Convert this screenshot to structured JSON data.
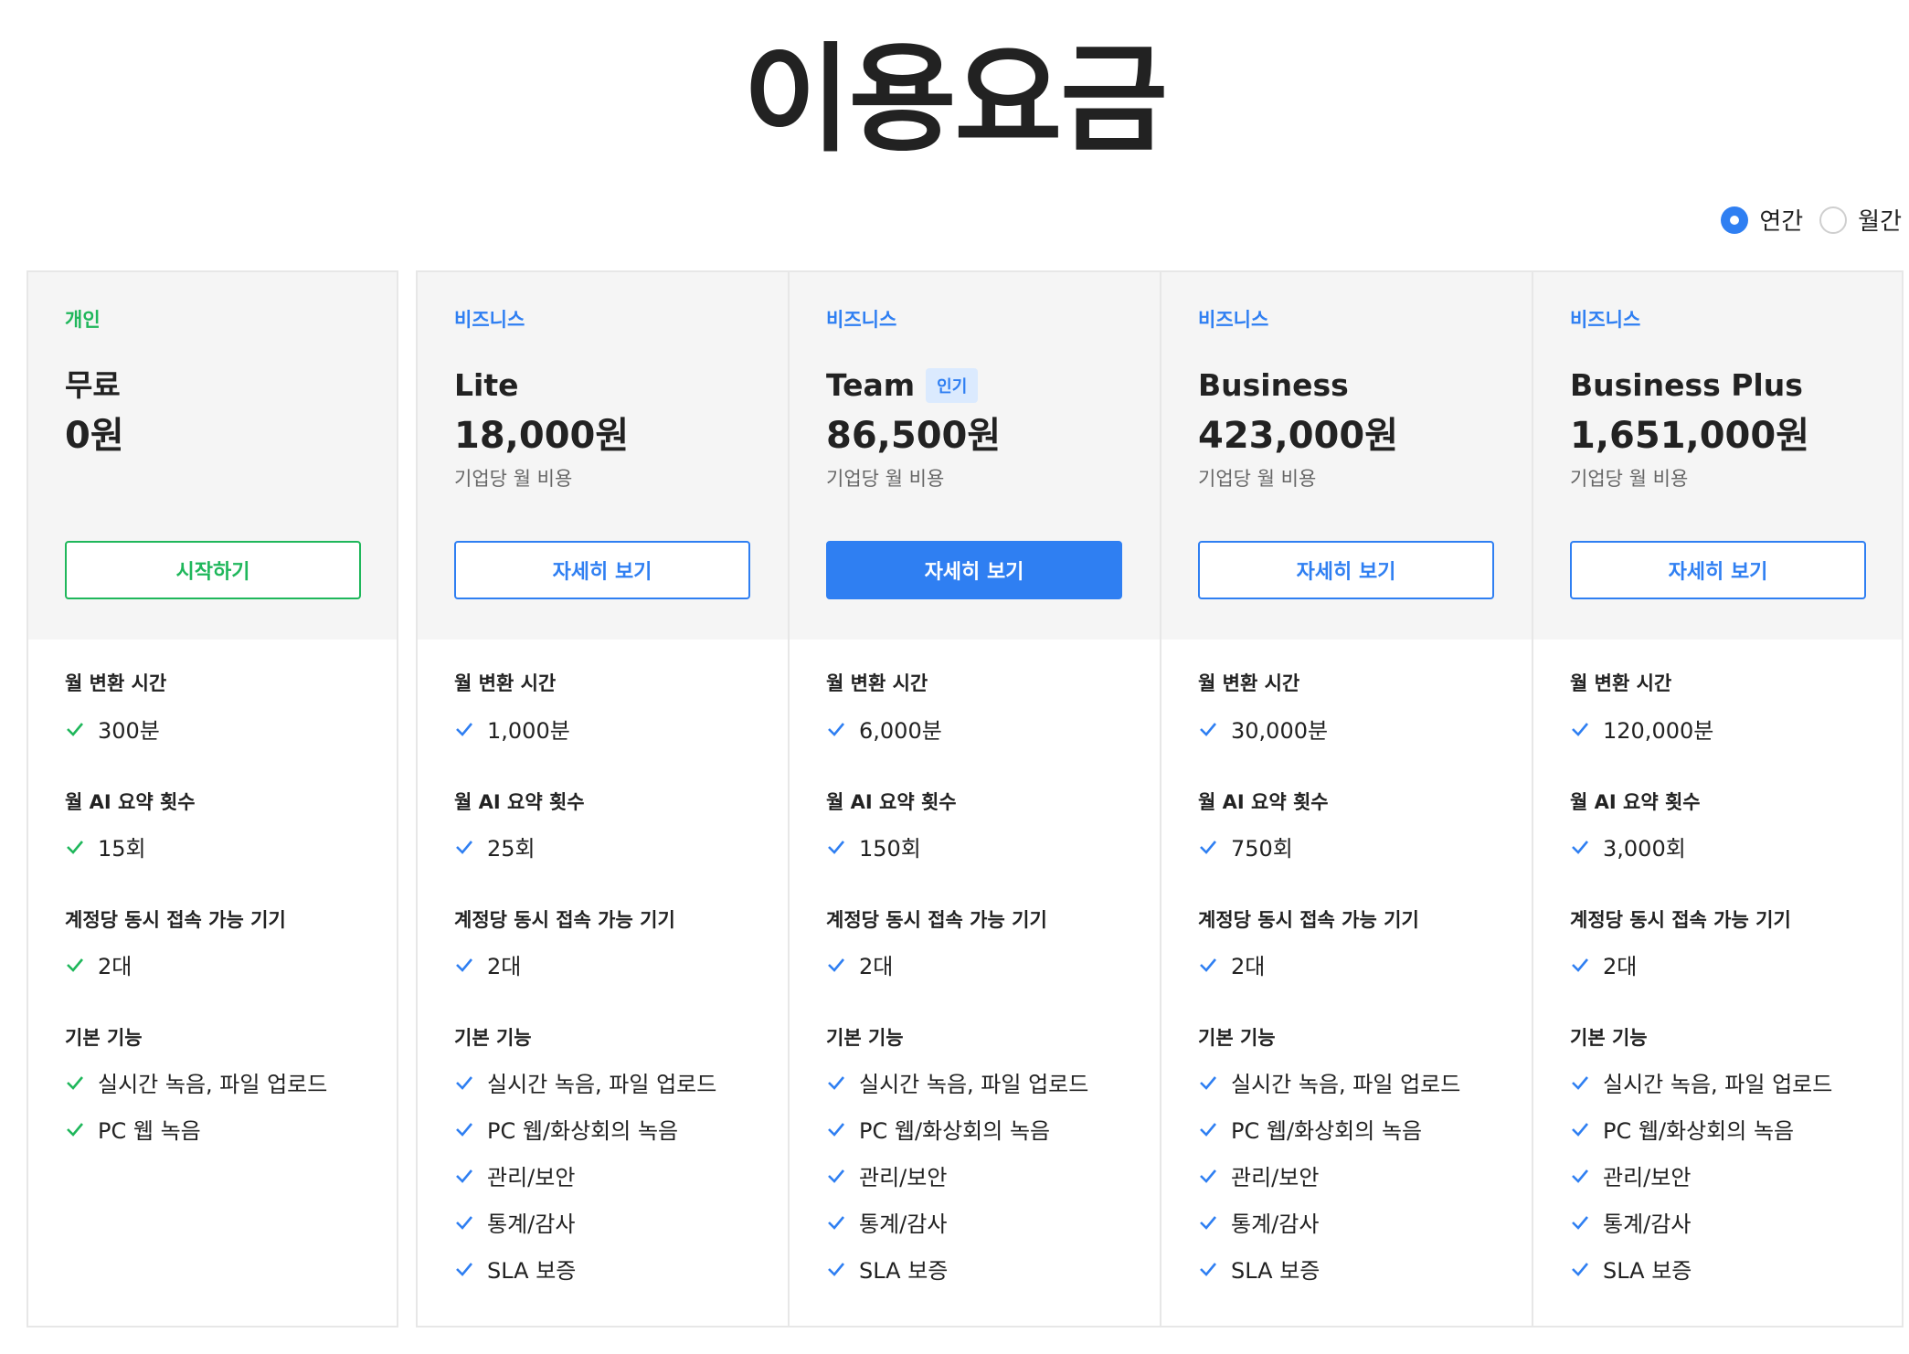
{
  "page": {
    "title": "이용요금"
  },
  "billing_toggle": {
    "options": [
      {
        "label": "연간",
        "selected": true
      },
      {
        "label": "월간",
        "selected": false
      }
    ]
  },
  "colors": {
    "green": "#1fb75b",
    "blue": "#2f7ff2",
    "card_top_bg": "#f5f5f5"
  },
  "section_labels": {
    "conversion": "월 변환 시간",
    "ai_summary": "월 AI 요약 횟수",
    "devices": "계정당 동시 접속 가능 기기",
    "basic": "기본 기능"
  },
  "plans": [
    {
      "category": "개인",
      "name": "무료",
      "badge": "",
      "price": "0원",
      "sub": "",
      "cta": "시작하기",
      "conversion": "300분",
      "ai_summary": "15회",
      "devices": "2대",
      "features": [
        "실시간 녹음, 파일 업로드",
        "PC 웹 녹음"
      ]
    },
    {
      "category": "비즈니스",
      "name": "Lite",
      "badge": "",
      "price": "18,000원",
      "sub": "기업당 월 비용",
      "cta": "자세히 보기",
      "conversion": "1,000분",
      "ai_summary": "25회",
      "devices": "2대",
      "features": [
        "실시간 녹음, 파일 업로드",
        "PC 웹/화상회의 녹음",
        "관리/보안",
        "통계/감사",
        "SLA 보증"
      ]
    },
    {
      "category": "비즈니스",
      "name": "Team",
      "badge": "인기",
      "price": "86,500원",
      "sub": "기업당 월 비용",
      "cta": "자세히 보기",
      "conversion": "6,000분",
      "ai_summary": "150회",
      "devices": "2대",
      "features": [
        "실시간 녹음, 파일 업로드",
        "PC 웹/화상회의 녹음",
        "관리/보안",
        "통계/감사",
        "SLA 보증"
      ]
    },
    {
      "category": "비즈니스",
      "name": "Business",
      "badge": "",
      "price": "423,000원",
      "sub": "기업당 월 비용",
      "cta": "자세히 보기",
      "conversion": "30,000분",
      "ai_summary": "750회",
      "devices": "2대",
      "features": [
        "실시간 녹음, 파일 업로드",
        "PC 웹/화상회의 녹음",
        "관리/보안",
        "통계/감사",
        "SLA 보증"
      ]
    },
    {
      "category": "비즈니스",
      "name": "Business Plus",
      "badge": "",
      "price": "1,651,000원",
      "sub": "기업당 월 비용",
      "cta": "자세히 보기",
      "conversion": "120,000분",
      "ai_summary": "3,000회",
      "devices": "2대",
      "features": [
        "실시간 녹음, 파일 업로드",
        "PC 웹/화상회의 녹음",
        "관리/보안",
        "통계/감사",
        "SLA 보증"
      ]
    }
  ]
}
